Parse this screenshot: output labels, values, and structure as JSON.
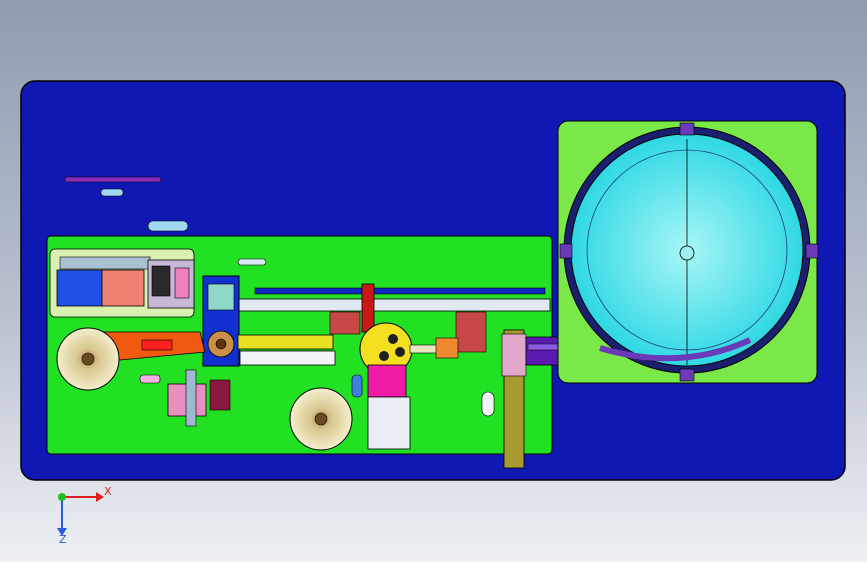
{
  "viewport": {
    "background_top": "#8f9bb0",
    "background_bottom": "#eef0f4"
  },
  "assembly": {
    "base_plate_color": "#1018b4",
    "outline_color": "#000000",
    "component_colors": {
      "sub_plate": "#22e022",
      "feeder_plate": "#7be84a",
      "bowl": "#35e0e8",
      "bowl_inner": "#7ff0f0",
      "tape_reel": "#f2ecc0",
      "orange_arm": "#f05a10",
      "magenta_block": "#f01ca8",
      "yellow_wheel": "#f4e020",
      "red_rail": "#c81818",
      "purple_track": "#5a1ab0",
      "blue_block": "#1030d0",
      "olive_column": "#a89a30",
      "salmon_block": "#f08070",
      "light_green_panel": "#d8f0b0",
      "brown_block": "#8a3a28",
      "light_blue_part": "#9fd8ee"
    }
  },
  "triad": {
    "x_label": "X",
    "z_label": "Z",
    "x_color": "#e02020",
    "y_color": "#20c020",
    "z_color": "#2a5cd8"
  }
}
